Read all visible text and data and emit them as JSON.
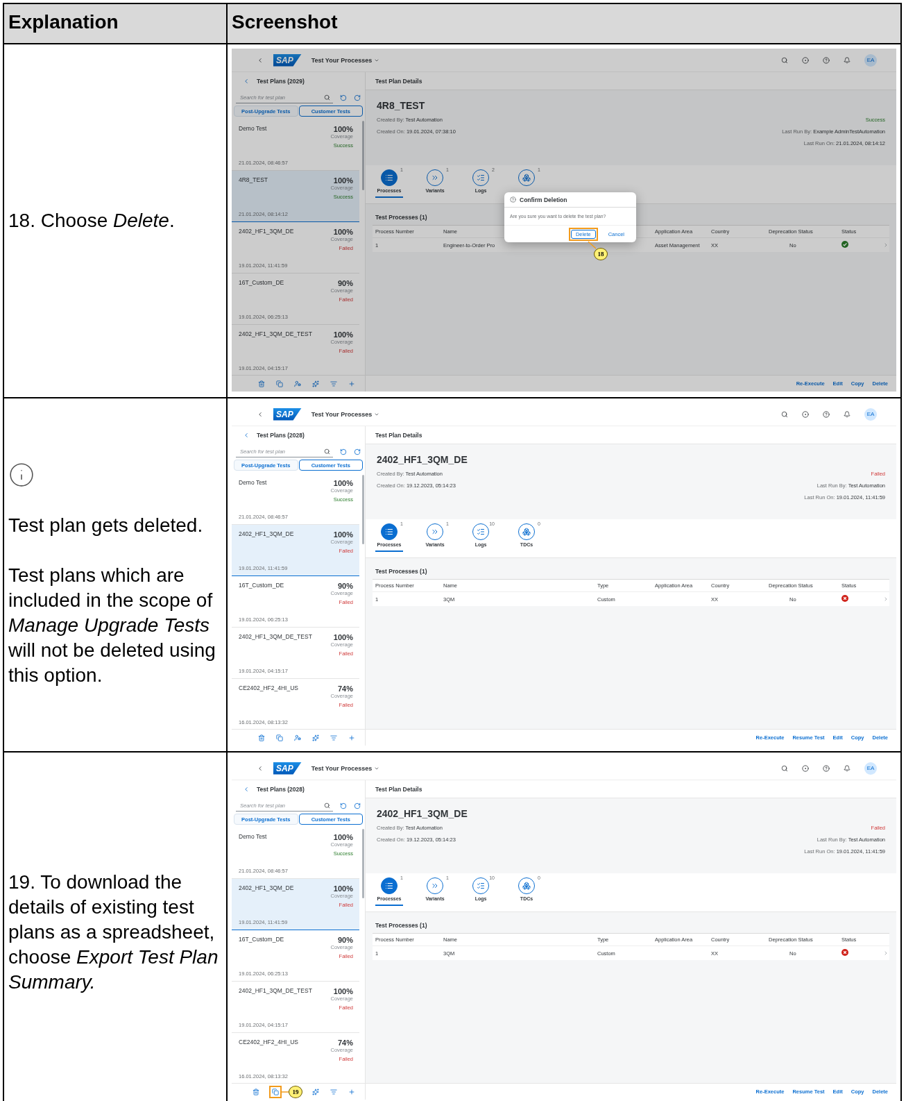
{
  "header": {
    "explanation": "Explanation",
    "screenshot": "Screenshot"
  },
  "rows": [
    {
      "explanation": {
        "info_icon": false,
        "paragraphs": [
          "18. Choose *Delete*."
        ]
      },
      "screen": {
        "dimmed": true,
        "callout": "18",
        "shell": {
          "logo": "SAP",
          "title": "Test Your Processes",
          "avatar": "EA"
        },
        "sidebar": {
          "title": "Test Plans (2029)",
          "search_placeholder": "Search for test plan",
          "segments": [
            {
              "label": "Post-Upgrade Tests",
              "selected": false
            },
            {
              "label": "Customer Tests",
              "selected": true
            }
          ],
          "items": [
            {
              "name": "Demo Test",
              "coverage": "100%",
              "coverage_label": "Coverage",
              "result": "Success",
              "kind": "success",
              "date": "21.01.2024, 08:46:57",
              "selected": false
            },
            {
              "name": "4R8_TEST",
              "coverage": "100%",
              "coverage_label": "Coverage",
              "result": "Success",
              "kind": "success",
              "date": "21.01.2024, 08:14:12",
              "selected": true
            },
            {
              "name": "2402_HF1_3QM_DE",
              "coverage": "100%",
              "coverage_label": "Coverage",
              "result": "Failed",
              "kind": "failed",
              "date": "19.01.2024, 11:41:59",
              "selected": false
            },
            {
              "name": "16T_Custom_DE",
              "coverage": "90%",
              "coverage_label": "Coverage",
              "result": "Failed",
              "kind": "failed",
              "date": "19.01.2024, 06:25:13",
              "selected": false
            },
            {
              "name": "2402_HF1_3QM_DE_TEST",
              "coverage": "100%",
              "coverage_label": "Coverage",
              "result": "Failed",
              "kind": "failed",
              "date": "19.01.2024, 04:15:17",
              "selected": false
            }
          ],
          "footer_icons": [
            {
              "kind": "delete",
              "highlighted": false
            },
            {
              "kind": "export",
              "highlighted": false
            },
            {
              "kind": "user",
              "highlighted": false
            },
            {
              "kind": "sparkle",
              "highlighted": false
            },
            {
              "kind": "filter",
              "highlighted": false
            },
            {
              "kind": "add",
              "highlighted": false
            }
          ]
        },
        "details": {
          "header": "Test Plan Details",
          "title": "4R8_TEST",
          "created_by": {
            "label": "Created By:",
            "value": "Test Automation"
          },
          "created_on": {
            "label": "Created On:",
            "value": "19.01.2024, 07:38:10"
          },
          "status": {
            "text": "Success",
            "kind": "success"
          },
          "last_run_by": {
            "label": "Last Run By:",
            "value": "Example AdminTestAutomation"
          },
          "last_run_on": {
            "label": "Last Run On:",
            "value": "21.01.2024, 08:14:12"
          },
          "tabs": [
            {
              "kind": "processes",
              "label": "Processes",
              "count": "1",
              "selected": true
            },
            {
              "kind": "variants",
              "label": "Variants",
              "count": "1",
              "selected": false
            },
            {
              "kind": "logs",
              "label": "Logs",
              "count": "2",
              "selected": false
            },
            {
              "kind": "tdcs",
              "count": "1",
              "selected": false
            }
          ],
          "table_title": "Test Processes (1)",
          "columns": [
            {
              "kind": "text",
              "label": "Process Number"
            },
            {
              "kind": "text",
              "label": "Name"
            },
            {
              "kind": "covered"
            },
            {
              "kind": "text",
              "label": "Application Area"
            },
            {
              "kind": "text",
              "label": "Country"
            },
            {
              "kind": "text",
              "label": "Deprecation Status"
            },
            {
              "kind": "text",
              "label": "Status"
            }
          ],
          "table_rows": [
            {
              "cells": [
                {
                  "kind": "text",
                  "text": "1"
                },
                {
                  "kind": "text",
                  "text": "Engineer-to-Order Pro"
                },
                {
                  "kind": "covered"
                },
                {
                  "kind": "text",
                  "text": "Asset Management"
                },
                {
                  "kind": "text",
                  "text": "XX"
                },
                {
                  "kind": "centered",
                  "text": "No"
                },
                {
                  "kind": "success"
                }
              ]
            }
          ],
          "actions": [
            "Re-Execute",
            "Edit",
            "Copy",
            "Delete"
          ]
        },
        "dialog": {
          "title": "Confirm Deletion",
          "message": "Are you sure you want to delete the test plan?",
          "buttons": [
            {
              "label": "Delete",
              "highlighted": true
            },
            {
              "label": "Cancel",
              "highlighted": false
            }
          ]
        }
      }
    },
    {
      "explanation": {
        "info_icon": true,
        "paragraphs": [
          "Test plan gets deleted.",
          "Test plans which are included in the scope of *Manage Upgrade Tests* will not be deleted using this option."
        ]
      },
      "screen": {
        "dimmed": false,
        "shell": {
          "logo": "SAP",
          "title": "Test Your Processes",
          "avatar": "EA"
        },
        "sidebar": {
          "title": "Test Plans (2028)",
          "search_placeholder": "Search for test plan",
          "segments": [
            {
              "label": "Post-Upgrade Tests",
              "selected": false
            },
            {
              "label": "Customer Tests",
              "selected": true
            }
          ],
          "items": [
            {
              "name": "Demo Test",
              "coverage": "100%",
              "coverage_label": "Coverage",
              "result": "Success",
              "kind": "success",
              "date": "21.01.2024, 08:46:57",
              "selected": false
            },
            {
              "name": "2402_HF1_3QM_DE",
              "coverage": "100%",
              "coverage_label": "Coverage",
              "result": "Failed",
              "kind": "failed",
              "date": "19.01.2024, 11:41:59",
              "selected": true
            },
            {
              "name": "16T_Custom_DE",
              "coverage": "90%",
              "coverage_label": "Coverage",
              "result": "Failed",
              "kind": "failed",
              "date": "19.01.2024, 06:25:13",
              "selected": false
            },
            {
              "name": "2402_HF1_3QM_DE_TEST",
              "coverage": "100%",
              "coverage_label": "Coverage",
              "result": "Failed",
              "kind": "failed",
              "date": "19.01.2024, 04:15:17",
              "selected": false
            },
            {
              "name": "CE2402_HF2_4HI_US",
              "coverage": "74%",
              "coverage_label": "Coverage",
              "result": "Failed",
              "kind": "failed",
              "date": "16.01.2024, 08:13:32",
              "selected": false
            }
          ],
          "footer_icons": [
            {
              "kind": "delete",
              "highlighted": false
            },
            {
              "kind": "export",
              "highlighted": false
            },
            {
              "kind": "user",
              "highlighted": false
            },
            {
              "kind": "sparkle",
              "highlighted": false
            },
            {
              "kind": "filter",
              "highlighted": false
            },
            {
              "kind": "add",
              "highlighted": false
            }
          ]
        },
        "details": {
          "header": "Test Plan Details",
          "title": "2402_HF1_3QM_DE",
          "created_by": {
            "label": "Created By:",
            "value": "Test Automation"
          },
          "created_on": {
            "label": "Created On:",
            "value": "19.12.2023, 05:14:23"
          },
          "status": {
            "text": "Failed",
            "kind": "failed"
          },
          "last_run_by": {
            "label": "Last Run By:",
            "value": "Test Automation"
          },
          "last_run_on": {
            "label": "Last Run On:",
            "value": "19.01.2024, 11:41:59"
          },
          "tabs": [
            {
              "kind": "processes",
              "label": "Processes",
              "count": "1",
              "selected": true
            },
            {
              "kind": "variants",
              "label": "Variants",
              "count": "1",
              "selected": false
            },
            {
              "kind": "logs",
              "label": "Logs",
              "count": "10",
              "selected": false
            },
            {
              "kind": "tdcs",
              "label": "TDCs",
              "count": "0",
              "selected": false
            }
          ],
          "table_title": "Test Processes (1)",
          "columns": [
            {
              "kind": "text",
              "label": "Process Number"
            },
            {
              "kind": "text",
              "label": "Name"
            },
            {
              "kind": "text",
              "label": "Type"
            },
            {
              "kind": "text",
              "label": "Application Area"
            },
            {
              "kind": "text",
              "label": "Country"
            },
            {
              "kind": "text",
              "label": "Deprecation Status"
            },
            {
              "kind": "text",
              "label": "Status"
            }
          ],
          "table_rows": [
            {
              "cells": [
                {
                  "kind": "text",
                  "text": "1"
                },
                {
                  "kind": "text",
                  "text": "3QM"
                },
                {
                  "kind": "text",
                  "text": "Custom"
                },
                {
                  "kind": "blank"
                },
                {
                  "kind": "text",
                  "text": "XX"
                },
                {
                  "kind": "centered",
                  "text": "No"
                },
                {
                  "kind": "error"
                }
              ]
            }
          ],
          "actions": [
            "Re-Execute",
            "Resume Test",
            "Edit",
            "Copy",
            "Delete"
          ]
        }
      }
    },
    {
      "explanation": {
        "info_icon": false,
        "paragraphs": [
          "19. To download the details of existing test plans as a spreadsheet, choose *Export Test Plan Summary.*"
        ]
      },
      "screen": {
        "dimmed": false,
        "callout": "19",
        "shell": {
          "logo": "SAP",
          "title": "Test Your Processes",
          "avatar": "EA"
        },
        "sidebar": {
          "title": "Test Plans (2028)",
          "search_placeholder": "Search for test plan",
          "segments": [
            {
              "label": "Post-Upgrade Tests",
              "selected": false
            },
            {
              "label": "Customer Tests",
              "selected": true
            }
          ],
          "items": [
            {
              "name": "Demo Test",
              "coverage": "100%",
              "coverage_label": "Coverage",
              "result": "Success",
              "kind": "success",
              "date": "21.01.2024, 08:46:57",
              "selected": false
            },
            {
              "name": "2402_HF1_3QM_DE",
              "coverage": "100%",
              "coverage_label": "Coverage",
              "result": "Failed",
              "kind": "failed",
              "date": "19.01.2024, 11:41:59",
              "selected": true
            },
            {
              "name": "16T_Custom_DE",
              "coverage": "90%",
              "coverage_label": "Coverage",
              "result": "Failed",
              "kind": "failed",
              "date": "19.01.2024, 06:25:13",
              "selected": false
            },
            {
              "name": "2402_HF1_3QM_DE_TEST",
              "coverage": "100%",
              "coverage_label": "Coverage",
              "result": "Failed",
              "kind": "failed",
              "date": "19.01.2024, 04:15:17",
              "selected": false
            },
            {
              "name": "CE2402_HF2_4HI_US",
              "coverage": "74%",
              "coverage_label": "Coverage",
              "result": "Failed",
              "kind": "failed",
              "date": "16.01.2024, 08:13:32",
              "selected": false
            }
          ],
          "footer_icons": [
            {
              "kind": "delete",
              "highlighted": false
            },
            {
              "kind": "export",
              "highlighted": true
            },
            {
              "kind": "sparkle",
              "highlighted": false
            },
            {
              "kind": "filter",
              "highlighted": false
            },
            {
              "kind": "add",
              "highlighted": false
            }
          ]
        },
        "details": {
          "header": "Test Plan Details",
          "title": "2402_HF1_3QM_DE",
          "created_by": {
            "label": "Created By:",
            "value": "Test Automation"
          },
          "created_on": {
            "label": "Created On:",
            "value": "19.12.2023, 05:14:23"
          },
          "status": {
            "text": "Failed",
            "kind": "failed"
          },
          "last_run_by": {
            "label": "Last Run By:",
            "value": "Test Automation"
          },
          "last_run_on": {
            "label": "Last Run On:",
            "value": "19.01.2024, 11:41:59"
          },
          "tabs": [
            {
              "kind": "processes",
              "label": "Processes",
              "count": "1",
              "selected": true
            },
            {
              "kind": "variants",
              "label": "Variants",
              "count": "1",
              "selected": false
            },
            {
              "kind": "logs",
              "label": "Logs",
              "count": "10",
              "selected": false
            },
            {
              "kind": "tdcs",
              "label": "TDCs",
              "count": "0",
              "selected": false
            }
          ],
          "table_title": "Test Processes (1)",
          "columns": [
            {
              "kind": "text",
              "label": "Process Number"
            },
            {
              "kind": "text",
              "label": "Name"
            },
            {
              "kind": "text",
              "label": "Type"
            },
            {
              "kind": "text",
              "label": "Application Area"
            },
            {
              "kind": "text",
              "label": "Country"
            },
            {
              "kind": "text",
              "label": "Deprecation Status"
            },
            {
              "kind": "text",
              "label": "Status"
            }
          ],
          "table_rows": [
            {
              "cells": [
                {
                  "kind": "text",
                  "text": "1"
                },
                {
                  "kind": "text",
                  "text": "3QM"
                },
                {
                  "kind": "text",
                  "text": "Custom"
                },
                {
                  "kind": "blank"
                },
                {
                  "kind": "text",
                  "text": "XX"
                },
                {
                  "kind": "centered",
                  "text": "No"
                },
                {
                  "kind": "error"
                }
              ]
            }
          ],
          "actions": [
            "Re-Execute",
            "Resume Test",
            "Edit",
            "Copy",
            "Delete"
          ]
        }
      }
    }
  ]
}
